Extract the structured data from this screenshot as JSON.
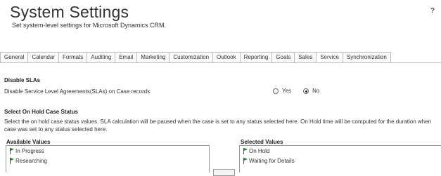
{
  "header": {
    "title": "System Settings",
    "subtitle": "Set system-level settings for Microsoft Dynamics CRM.",
    "help": "?"
  },
  "tabs": [
    {
      "label": "General"
    },
    {
      "label": "Calendar"
    },
    {
      "label": "Formats"
    },
    {
      "label": "Auditing"
    },
    {
      "label": "Email"
    },
    {
      "label": "Marketing"
    },
    {
      "label": "Customization"
    },
    {
      "label": "Outlook"
    },
    {
      "label": "Reporting"
    },
    {
      "label": "Goals"
    },
    {
      "label": "Sales"
    },
    {
      "label": "Service"
    },
    {
      "label": "Synchronization"
    }
  ],
  "active_tab": "Service",
  "sla": {
    "heading": "Disable SLAs",
    "label": "Disable Service Level Agreements(SLAs) on Case records",
    "yes": "Yes",
    "no": "No",
    "selected": "No"
  },
  "onhold": {
    "heading": "Select On Hold Case Status",
    "description": "Select the on hold case status values. SLA calculation will be paused when the case is set to any status selected here. On Hold time will be computed for the duration when case was set to any status selected here.",
    "available_label": "Available Values",
    "selected_label": "Selected Values",
    "available": [
      "In Progress",
      "Researching"
    ],
    "selected": [
      "On Hold",
      "Waiting for Details"
    ]
  },
  "colors": {
    "flag": "#2e7d32",
    "border": "#bdbdbd"
  }
}
